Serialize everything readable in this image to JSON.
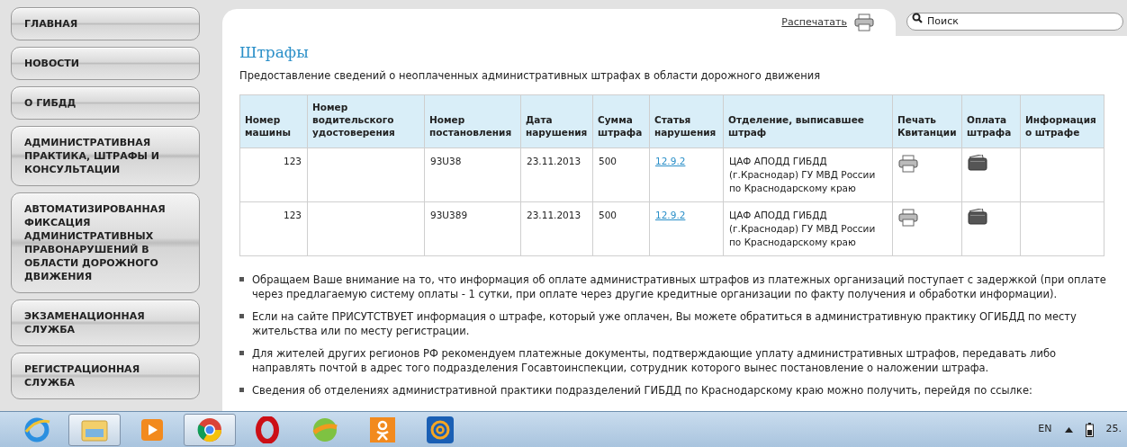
{
  "sidebar": {
    "items": [
      {
        "label": "ГЛАВНАЯ"
      },
      {
        "label": "НОВОСТИ"
      },
      {
        "label": "О ГИБДД"
      },
      {
        "label": "АДМИНИСТРАТИВНАЯ ПРАКТИКА, ШТРАФЫ И КОНСУЛЬТАЦИИ"
      },
      {
        "label": "АВТОМАТИЗИРОВАННАЯ ФИКСАЦИЯ АДМИНИСТРАТИВНЫХ ПРАВОНАРУШЕНИЙ В ОБЛАСТИ ДОРОЖНОГО ДВИЖЕНИЯ"
      },
      {
        "label": "ЭКЗАМЕНАЦИОННАЯ СЛУЖБА"
      },
      {
        "label": "РЕГИСТРАЦИОННАЯ СЛУЖБА"
      }
    ]
  },
  "print_link": "Распечатать",
  "search": {
    "placeholder": "Поиск"
  },
  "page": {
    "title": "Штрафы",
    "subtitle": "Предоставление сведений о неоплаченных административных штрафах в области дорожного движения"
  },
  "table": {
    "columns": [
      "Номер машины",
      "Номер водительского удостоверения",
      "Номер постановления",
      "Дата нарушения",
      "Сумма штрафа",
      "Статья нарушения",
      "Отделение, выписавшее штраф",
      "Печать Квитанции",
      "Оплата штрафа",
      "Информация о штрафе"
    ],
    "rows": [
      {
        "car": "123",
        "decree": "93U38",
        "date": "23.11.2013",
        "sum": "500",
        "article": "12.9.2",
        "department": "ЦАФ АПОДД ГИБДД (г.Краснодар) ГУ МВД России по Краснодарскому краю"
      },
      {
        "car": "123",
        "decree": "93U389",
        "date": "23.11.2013",
        "sum": "500",
        "article": "12.9.2",
        "department": "ЦАФ АПОДД ГИБДД (г.Краснодар) ГУ МВД России по Краснодарскому краю"
      }
    ]
  },
  "notes": [
    "Обращаем Ваше внимание на то, что информация об оплате административных штрафов из платежных организаций поступает с задержкой (при оплате через предлагаемую систему оплаты - 1 сутки, при оплате через другие кредитные организации по факту получения и обработки информации).",
    "Если на сайте ПРИСУТСТВУЕТ информация о штрафе, который уже оплачен, Вы можете обратиться в административную практику ОГИБДД по месту жительства или по месту регистрации.",
    "Для жителей других регионов РФ рекомендуем платежные документы, подтверждающие уплату административных штрафов, передавать либо направлять почтой в адрес того подразделения Госавтоинспекции, сотрудник которого вынес постановление о наложении штрафа.",
    "Сведения об отделениях административной практики подразделений ГИБДД по Краснодарскому краю можно получить, перейдя по ссылке:"
  ],
  "taskbar": {
    "apps": [
      {
        "kind": "browser",
        "selected": false
      },
      {
        "kind": "folder",
        "selected": true
      },
      {
        "kind": "player",
        "selected": false
      },
      {
        "kind": "chrome",
        "selected": true
      },
      {
        "kind": "opera",
        "selected": false
      },
      {
        "kind": "ball",
        "selected": false
      },
      {
        "kind": "ok",
        "selected": false
      },
      {
        "kind": "mail",
        "selected": false
      }
    ],
    "language": "EN",
    "clock": "25."
  }
}
